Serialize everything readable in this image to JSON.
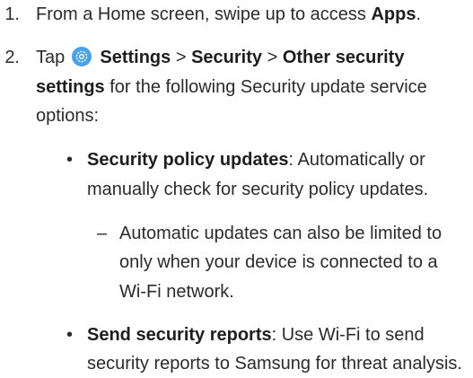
{
  "steps": [
    {
      "number": "1.",
      "text_before": "From a Home screen, swipe up to access ",
      "bold": "Apps",
      "text_after": "."
    },
    {
      "number": "2.",
      "lead": "Tap",
      "settings": "Settings",
      "sep1": ">",
      "security": "Security",
      "sep2": ">",
      "other_line1": "Other security",
      "other_line2": "settings",
      "line2_rest": " for the following Security update service",
      "line3": "options:"
    }
  ],
  "bullets": [
    {
      "symbol": "•",
      "bold": "Security policy updates",
      "line1_rest": ": Automatically or",
      "line2": "manually check for security policy updates."
    },
    {
      "symbol": "•",
      "bold": "Send security reports",
      "line1_rest": ": Use Wi-Fi to send",
      "line2": "security reports to Samsung for threat analysis."
    }
  ],
  "subitem": {
    "symbol": "–",
    "line1": "Automatic updates can also be limited to",
    "line2": "only when your device is connected to a",
    "line3": "Wi-Fi network."
  },
  "icon": {
    "name": "settings-gear-icon",
    "color": "#4ba0e6"
  }
}
